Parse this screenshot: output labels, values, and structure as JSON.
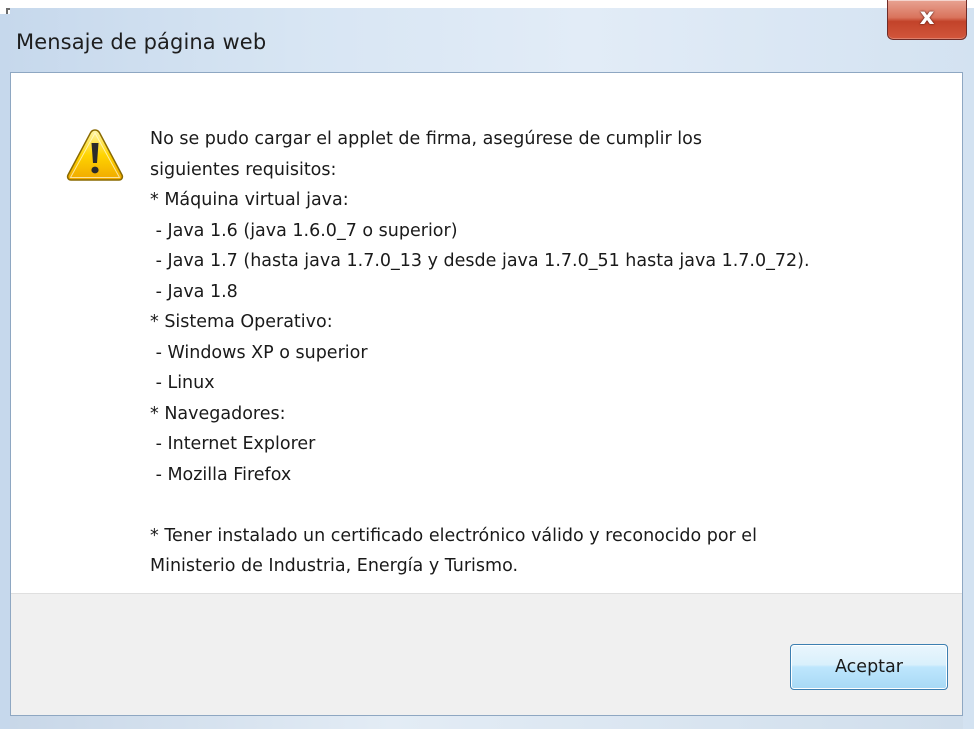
{
  "dialog": {
    "title": "Mensaje de página web",
    "close_label": "x",
    "icon": "warning-icon",
    "message_lines": [
      "No se pudo cargar el applet de firma, asegúrese de cumplir los",
      "siguientes requisitos:",
      "* Máquina virtual java:",
      " - Java 1.6 (java 1.6.0_7 o superior)",
      " - Java 1.7 (hasta java 1.7.0_13 y desde java 1.7.0_51 hasta java 1.7.0_72).",
      " - Java 1.8",
      "* Sistema Operativo:",
      " - Windows XP o superior",
      " - Linux",
      "* Navegadores:",
      " - Internet Explorer",
      " - Mozilla Firefox",
      "",
      "* Tener instalado un certificado electrónico válido y reconocido por el",
      "Ministerio de Industria, Energía y Turismo."
    ],
    "ok_label": "Aceptar"
  },
  "colors": {
    "frame": "#d7e5f3",
    "close_button": "#c2432a",
    "footer": "#f0f0f0",
    "button_border": "#3c7fb1",
    "warning_yellow": "#f5c800"
  }
}
